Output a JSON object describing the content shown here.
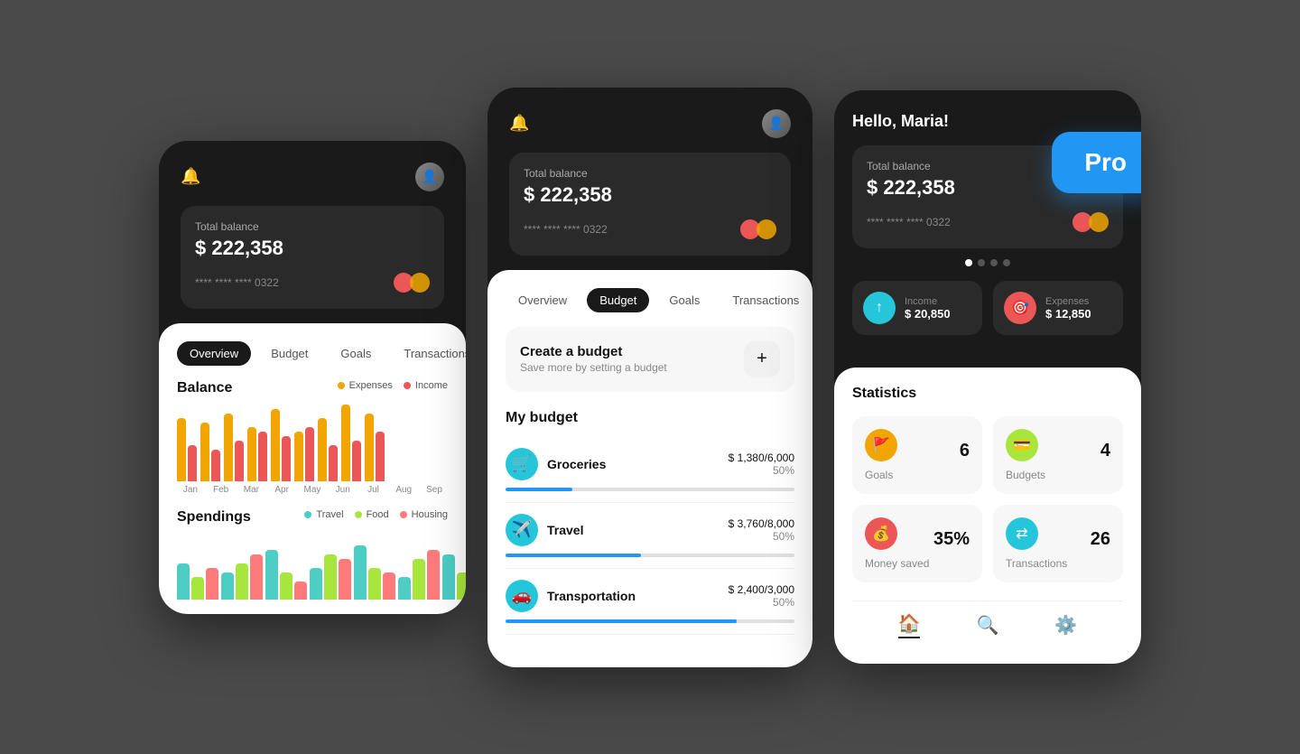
{
  "app": {
    "pro_label": "Pro"
  },
  "card1": {
    "greeting": "",
    "balance_label": "Total balance",
    "balance_amount": "$ 222,358",
    "card_number": "**** **** **** 0322",
    "tabs": [
      "Overview",
      "Budget",
      "Goals",
      "Transactions"
    ],
    "active_tab": "Overview",
    "balance_section": "Balance",
    "legend_expenses": "Expenses",
    "legend_income": "Income",
    "months": [
      "Jan",
      "Feb",
      "Mar",
      "Apr",
      "May",
      "Jun",
      "Jul",
      "Aug",
      "Sep"
    ],
    "bars": [
      {
        "orange": 70,
        "red": 40
      },
      {
        "orange": 65,
        "red": 35
      },
      {
        "orange": 75,
        "red": 45
      },
      {
        "orange": 60,
        "red": 55
      },
      {
        "orange": 80,
        "red": 50
      },
      {
        "orange": 55,
        "red": 60
      },
      {
        "orange": 70,
        "red": 40
      },
      {
        "orange": 85,
        "red": 45
      },
      {
        "orange": 75,
        "red": 55
      }
    ],
    "spendings_label": "Spendings",
    "spend_legend": [
      "Travel",
      "Food",
      "Housing"
    ]
  },
  "card2": {
    "balance_label": "Total balance",
    "balance_amount": "$ 222,358",
    "card_number": "**** **** **** 0322",
    "tabs": [
      "Overview",
      "Budget",
      "Goals",
      "Transactions"
    ],
    "active_tab": "Budget",
    "create_title": "Create a budget",
    "create_sub": "Save more by setting a budget",
    "my_budget_label": "My budget",
    "budget_items": [
      {
        "name": "Groceries",
        "amount": "$ 1,380/6,000",
        "pct": "50%",
        "fill": 23,
        "icon": "🛒"
      },
      {
        "name": "Travel",
        "amount": "$ 3,760/8,000",
        "pct": "50%",
        "fill": 47,
        "icon": "✈️"
      },
      {
        "name": "Transportation",
        "amount": "$ 2,400/3,000",
        "pct": "50%",
        "fill": 80,
        "icon": "🚗"
      }
    ]
  },
  "card3": {
    "greeting": "Hello, Maria!",
    "balance_label": "Total balance",
    "balance_amount": "$ 222,358",
    "card_number": "**** **** **** 0322",
    "income_label": "Income",
    "income_amount": "$ 20,850",
    "expense_label": "Expenses",
    "expense_amount": "$ 12,850",
    "stats_title": "Statistics",
    "stats": [
      {
        "label": "Goals",
        "value": "6",
        "icon": "🚩"
      },
      {
        "label": "Budgets",
        "value": "4",
        "icon": "💳"
      },
      {
        "label": "Money saved",
        "value": "35%",
        "icon": "💰"
      },
      {
        "label": "Transactions",
        "value": "26",
        "icon": "⇄"
      }
    ]
  }
}
